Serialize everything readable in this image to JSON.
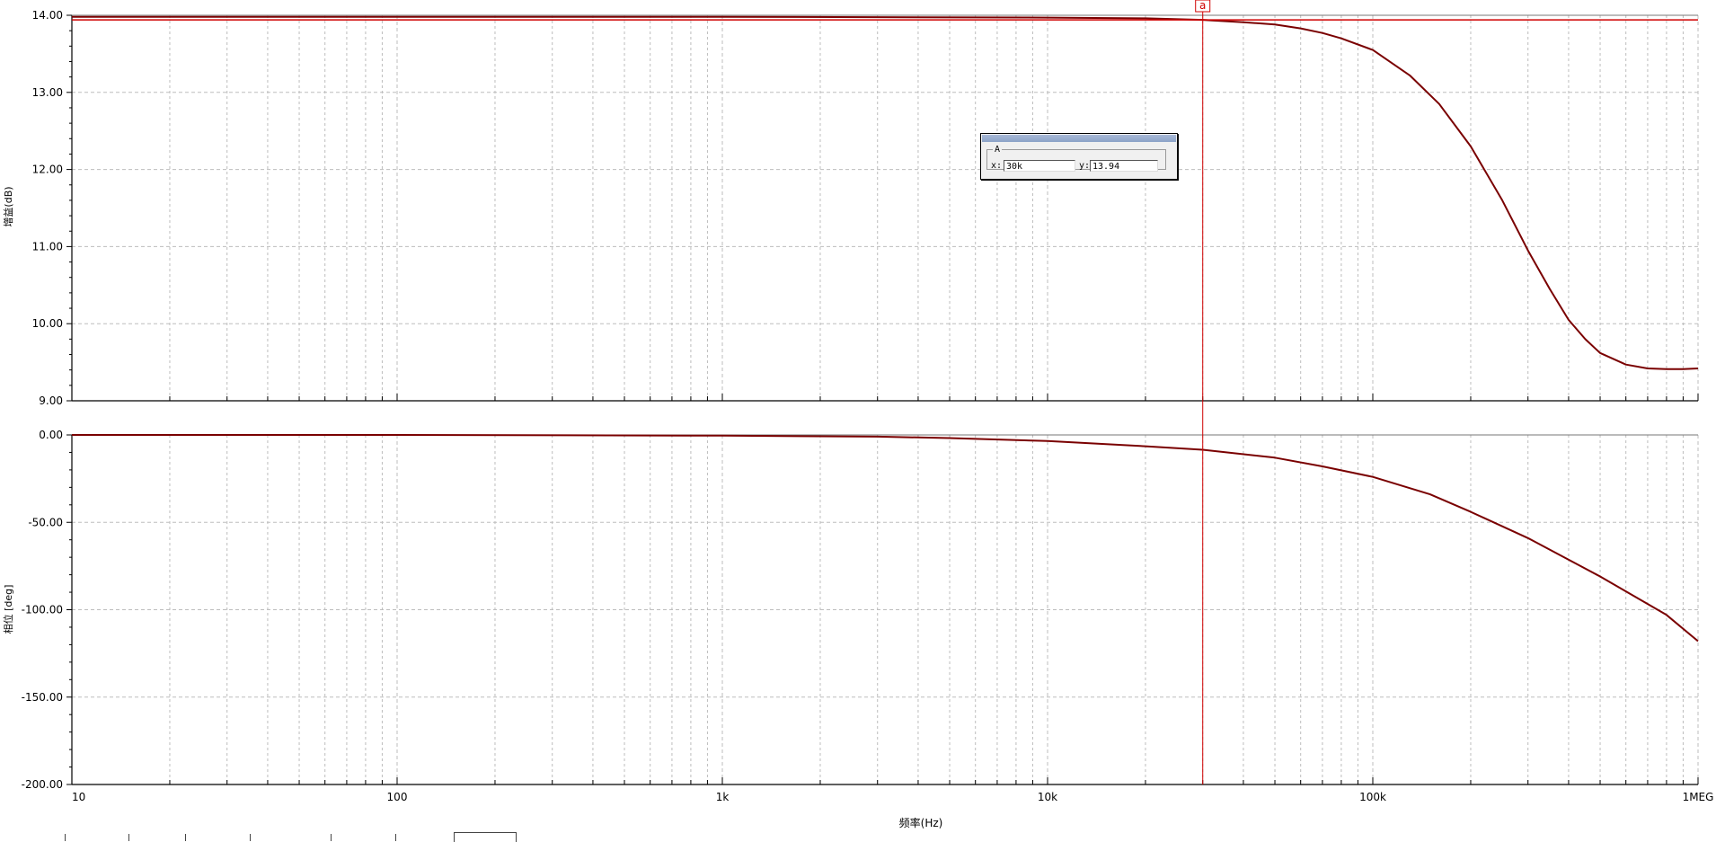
{
  "chart_data": [
    {
      "type": "line",
      "ylabel": "增益(dB)",
      "xlabel": "",
      "xscale": "log",
      "xlim": [
        10,
        1000000
      ],
      "ylim": [
        9.0,
        14.0
      ],
      "yticks": [
        9.0,
        10.0,
        11.0,
        12.0,
        13.0,
        14.0
      ],
      "ytick_labels": [
        "9.00",
        "10.00",
        "11.00",
        "12.00",
        "13.00",
        "14.00"
      ],
      "grid": true,
      "series": [
        {
          "color": "#7a0000",
          "x": [
            10,
            100,
            1000,
            10000,
            20000,
            30000,
            40000,
            50000,
            60000,
            70000,
            80000,
            100000,
            130000,
            160000,
            200000,
            250000,
            300000,
            350000,
            400000,
            450000,
            500000,
            600000,
            700000,
            800000,
            900000,
            1000000
          ],
          "y": [
            13.98,
            13.98,
            13.98,
            13.97,
            13.96,
            13.94,
            13.91,
            13.88,
            13.83,
            13.77,
            13.7,
            13.55,
            13.22,
            12.85,
            12.3,
            11.6,
            10.95,
            10.45,
            10.05,
            9.8,
            9.62,
            9.47,
            9.42,
            9.41,
            9.41,
            9.42
          ]
        }
      ]
    },
    {
      "type": "line",
      "ylabel": "相位 [deg]",
      "xlabel": "频率(Hz)",
      "xscale": "log",
      "xlim": [
        10,
        1000000
      ],
      "ylim": [
        -200,
        0
      ],
      "yticks": [
        -200,
        -150,
        -100,
        -50,
        0
      ],
      "ytick_labels": [
        "-200.00",
        "-150.00",
        "-100.00",
        "-50.00",
        "0.00"
      ],
      "xticks": [
        10,
        100,
        1000,
        10000,
        100000,
        1000000
      ],
      "xtick_labels": [
        "10",
        "100",
        "1k",
        "10k",
        "100k",
        "1MEG"
      ],
      "grid": true,
      "series": [
        {
          "color": "#7a0000",
          "x": [
            10,
            100,
            1000,
            3000,
            5000,
            10000,
            20000,
            30000,
            50000,
            70000,
            100000,
            150000,
            200000,
            300000,
            500000,
            800000,
            1000000
          ],
          "y": [
            0,
            0,
            -0.4,
            -1.0,
            -1.8,
            -3.5,
            -6.5,
            -8.5,
            -13,
            -18,
            -24,
            -34,
            -44,
            -59,
            -81,
            -103,
            -118
          ]
        }
      ]
    }
  ],
  "cursor": {
    "tag": "a",
    "x_value": 30000,
    "gain_reference": 13.94,
    "color": "#d00000",
    "box": {
      "legend": "A",
      "x_label": "x:",
      "x_value": "30k",
      "y_label": "y:",
      "y_value": "13.94"
    }
  },
  "colors": {
    "curve": "#7a0000",
    "cursor": "#d00000",
    "grid": "#bdbdbd",
    "axis": "#000000"
  }
}
